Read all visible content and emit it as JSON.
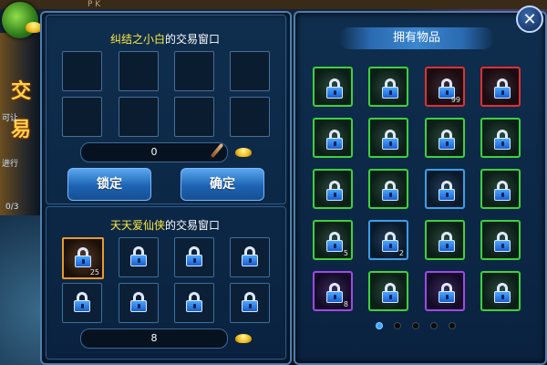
{
  "top_fragment": "P K",
  "side": {
    "title_char1": "交",
    "title_char2": "易",
    "frag1": "可让",
    "frag2": "进行",
    "frag3": "0/3"
  },
  "my_window": {
    "name": "纠结之小白",
    "suffix": "的交易窗口",
    "amount": "0",
    "lock_button": "锁定",
    "confirm_button": "确定"
  },
  "their_window": {
    "name": "天天爱仙侠",
    "suffix": "的交易窗口",
    "amount": "8",
    "slots": [
      {
        "border": "orange",
        "qty": "25"
      },
      {
        "border": "none",
        "qty": ""
      },
      {
        "border": "none",
        "qty": ""
      },
      {
        "border": "none",
        "qty": ""
      },
      {
        "border": "none",
        "qty": ""
      },
      {
        "border": "none",
        "qty": ""
      },
      {
        "border": "none",
        "qty": ""
      },
      {
        "border": "none",
        "qty": ""
      }
    ]
  },
  "inventory": {
    "title": "拥有物品",
    "items": [
      {
        "rarity": "green",
        "qty": ""
      },
      {
        "rarity": "green",
        "qty": ""
      },
      {
        "rarity": "red",
        "qty": "99"
      },
      {
        "rarity": "red",
        "qty": ""
      },
      {
        "rarity": "green",
        "qty": ""
      },
      {
        "rarity": "green",
        "qty": ""
      },
      {
        "rarity": "green",
        "qty": ""
      },
      {
        "rarity": "green",
        "qty": ""
      },
      {
        "rarity": "green",
        "qty": ""
      },
      {
        "rarity": "green",
        "qty": ""
      },
      {
        "rarity": "blue",
        "qty": ""
      },
      {
        "rarity": "green",
        "qty": ""
      },
      {
        "rarity": "green",
        "qty": "5"
      },
      {
        "rarity": "blue",
        "qty": "2"
      },
      {
        "rarity": "green",
        "qty": ""
      },
      {
        "rarity": "green",
        "qty": ""
      },
      {
        "rarity": "purple",
        "qty": "8"
      },
      {
        "rarity": "green",
        "qty": ""
      },
      {
        "rarity": "purple",
        "qty": ""
      },
      {
        "rarity": "green",
        "qty": ""
      }
    ],
    "page_count": 5,
    "current_page": 1
  },
  "close_label": "✕",
  "colors": {
    "gold_text": "#ffea40",
    "frame": "#4d7fae",
    "button": "#1d64b4"
  }
}
